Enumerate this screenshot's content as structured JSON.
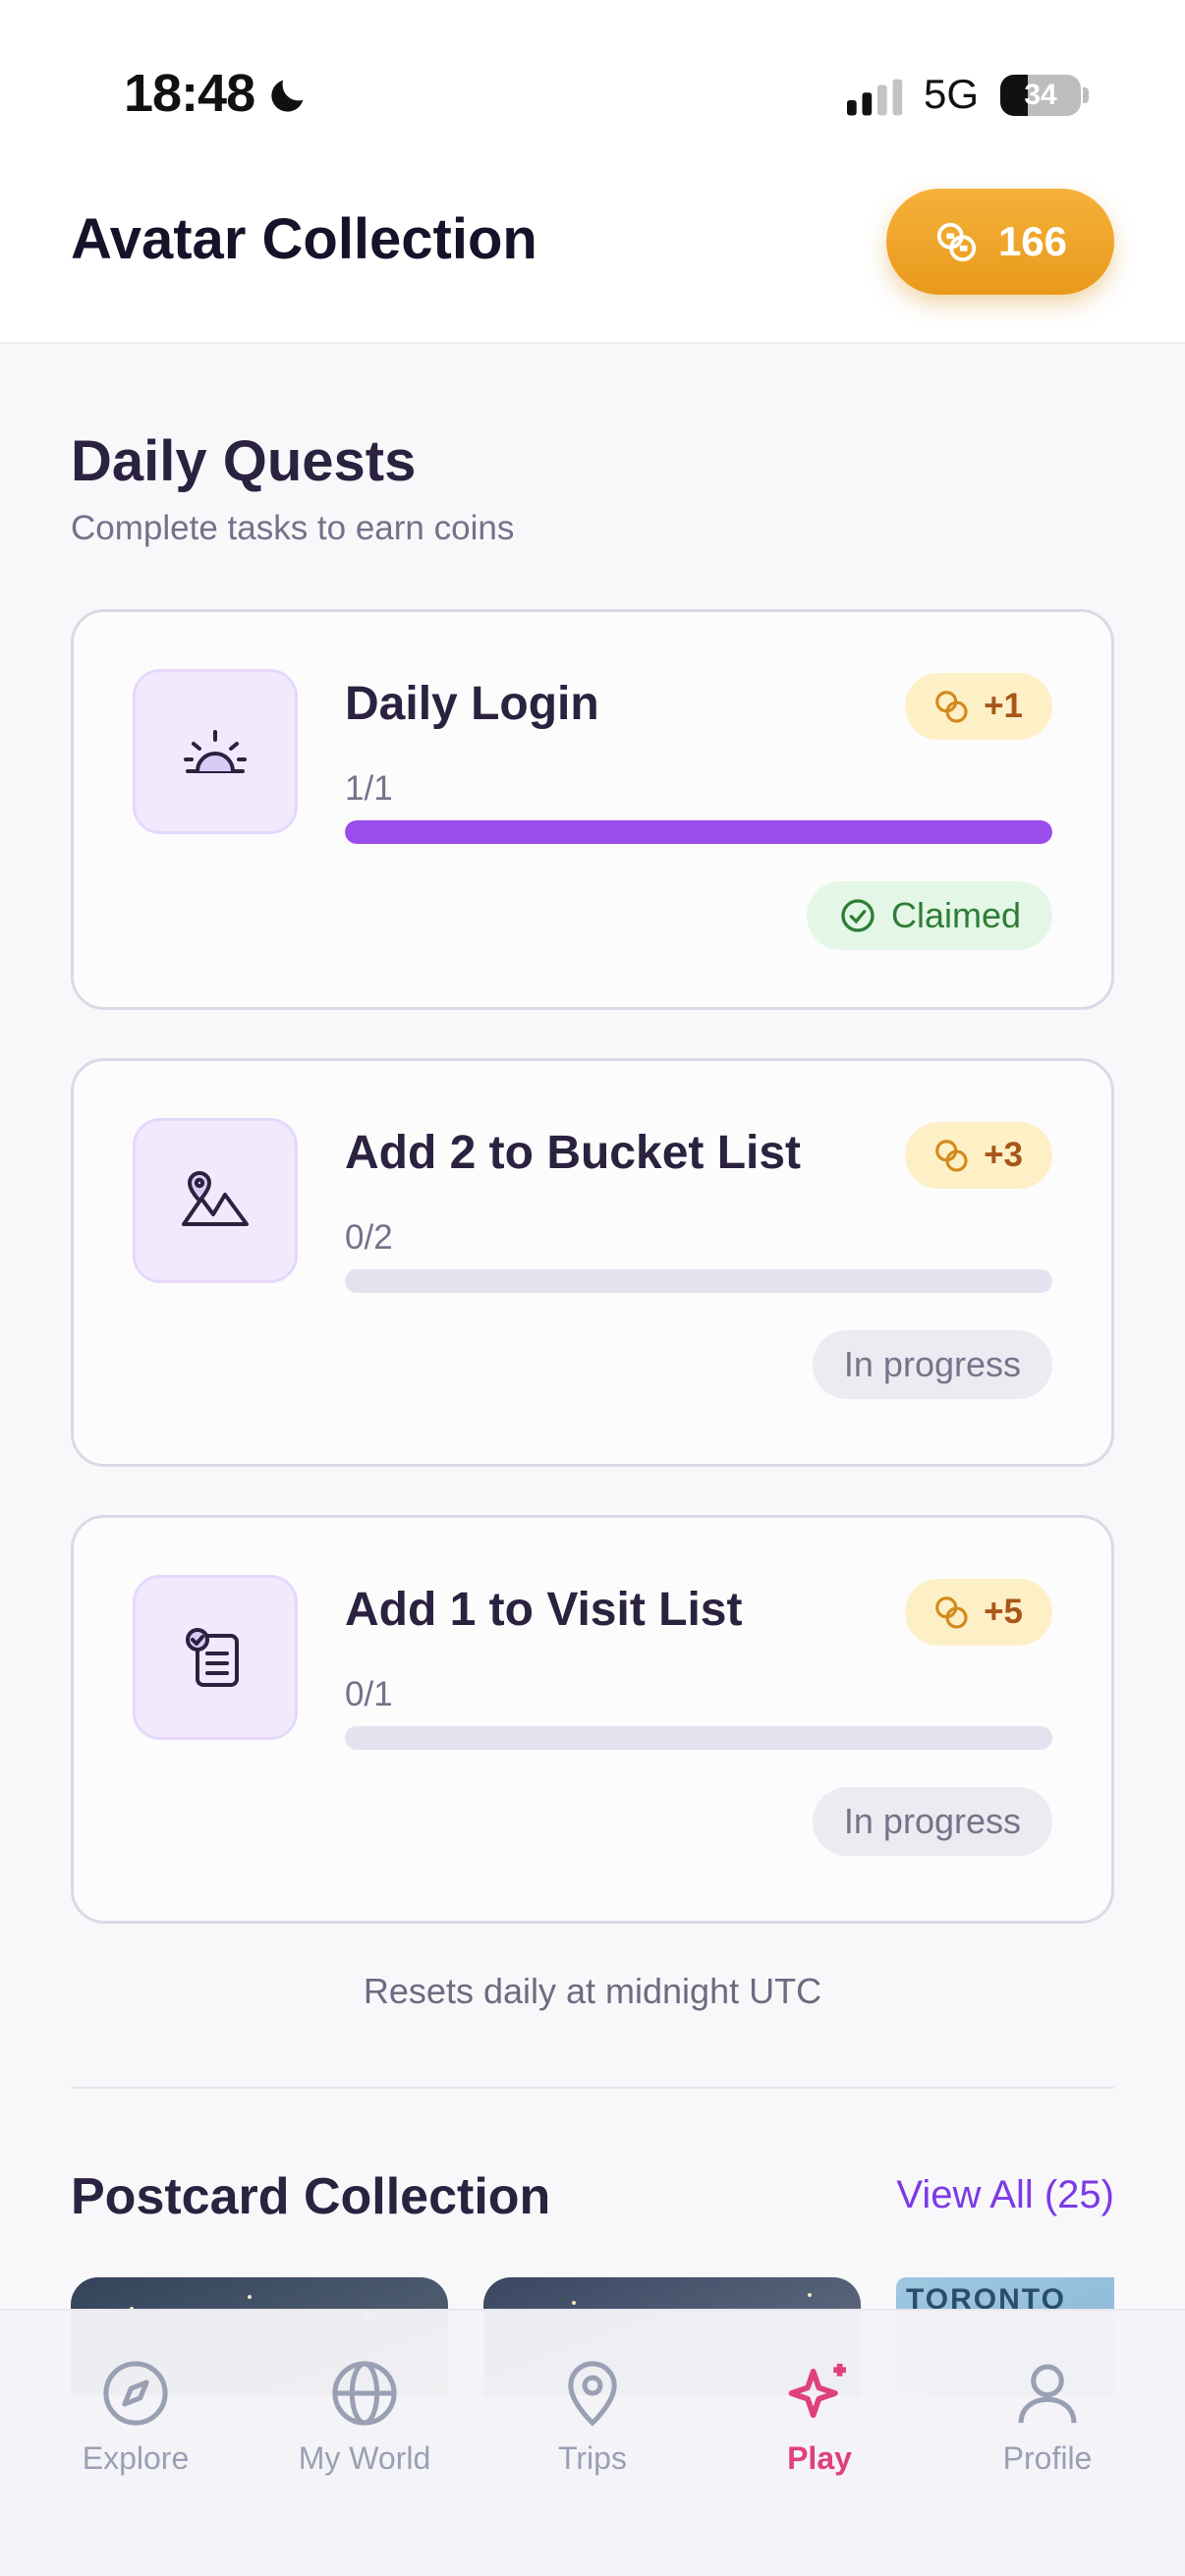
{
  "status_bar": {
    "time": "18:48",
    "network": "5G",
    "battery_level": "34",
    "battery_fraction": 0.34
  },
  "header": {
    "title": "Avatar Collection",
    "coin_balance": "166"
  },
  "daily_quests": {
    "title": "Daily Quests",
    "subtitle": "Complete tasks to earn coins",
    "quests": [
      {
        "icon": "sunrise-icon",
        "title": "Daily Login",
        "reward": "+1",
        "progress_text": "1/1",
        "progress_fraction": 1.0,
        "status": "Claimed"
      },
      {
        "icon": "map-pin-mountain-icon",
        "title": "Add 2 to Bucket List",
        "reward": "+3",
        "progress_text": "0/2",
        "progress_fraction": 0.0,
        "status": "In progress"
      },
      {
        "icon": "checklist-icon",
        "title": "Add 1 to Visit List",
        "reward": "+5",
        "progress_text": "0/1",
        "progress_fraction": 0.0,
        "status": "In progress"
      }
    ],
    "reset_note": "Resets daily at midnight UTC"
  },
  "postcards": {
    "title": "Postcard Collection",
    "view_all": "View All (25)",
    "third_card_label": "TORONTO"
  },
  "bottom_nav": {
    "items": [
      {
        "label": "Explore",
        "icon": "compass-icon"
      },
      {
        "label": "My World",
        "icon": "globe-icon"
      },
      {
        "label": "Trips",
        "icon": "map-pin-icon"
      },
      {
        "label": "Play",
        "icon": "sparkle-icon",
        "active": true
      },
      {
        "label": "Profile",
        "icon": "user-icon"
      }
    ]
  },
  "colors": {
    "accent_purple": "#9b4dec",
    "coin_orange": "#f0a52a",
    "play_pink": "#e0407c",
    "claimed_green": "#2e7d36"
  }
}
